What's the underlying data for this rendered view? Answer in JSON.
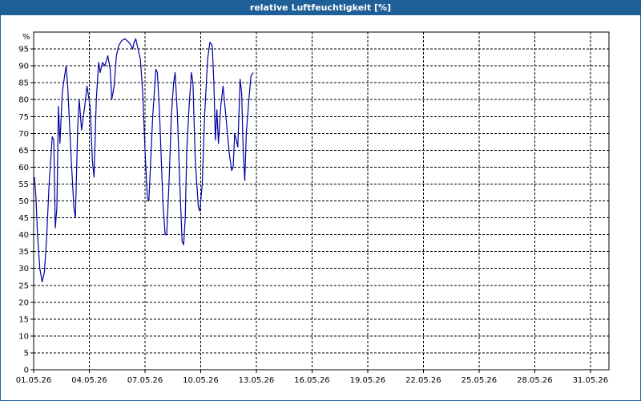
{
  "window": {
    "title": "relative Luftfeuchtigkeit [%]"
  },
  "colors": {
    "title_bar": "#1f5f97",
    "series": "#0000a0",
    "grid": "#000000",
    "plot_background": "#ffffff"
  },
  "chart_data": {
    "type": "line",
    "title": "relative Luftfeuchtigkeit [%]",
    "ylabel": "%",
    "xlabel": "",
    "grid": true,
    "grid_style": "dashed",
    "ylim": [
      0,
      100
    ],
    "xlim": [
      "01.05.26",
      "01.06.26"
    ],
    "y_ticks": [
      0,
      5,
      10,
      15,
      20,
      25,
      30,
      35,
      40,
      45,
      50,
      55,
      60,
      65,
      70,
      75,
      80,
      85,
      90,
      95
    ],
    "x_ticks": [
      {
        "label": "01.05.26",
        "date": "2026-05-01"
      },
      {
        "label": "04.05.26",
        "date": "2026-05-04"
      },
      {
        "label": "07.05.26",
        "date": "2026-05-07"
      },
      {
        "label": "10.05.26",
        "date": "2026-05-10"
      },
      {
        "label": "13.05.26",
        "date": "2026-05-13"
      },
      {
        "label": "16.05.26",
        "date": "2026-05-16"
      },
      {
        "label": "19.05.26",
        "date": "2026-05-19"
      },
      {
        "label": "22.05.26",
        "date": "2026-05-22"
      },
      {
        "label": "25.05.26",
        "date": "2026-05-25"
      },
      {
        "label": "28.05.26",
        "date": "2026-05-28"
      },
      {
        "label": "31.05.26",
        "date": "2026-05-31"
      }
    ],
    "series": [
      {
        "points": [
          [
            "2026-05-01 01:00",
            57
          ],
          [
            "2026-05-01 03:00",
            51
          ],
          [
            "2026-05-01 05:00",
            40
          ],
          [
            "2026-05-01 08:00",
            30
          ],
          [
            "2026-05-01 11:00",
            26
          ],
          [
            "2026-05-01 14:00",
            29
          ],
          [
            "2026-05-01 17:00",
            40
          ],
          [
            "2026-05-01 20:00",
            55
          ],
          [
            "2026-05-02 00:00",
            69
          ],
          [
            "2026-05-02 02:00",
            68
          ],
          [
            "2026-05-02 04:00",
            42
          ],
          [
            "2026-05-02 06:00",
            48
          ],
          [
            "2026-05-02 08:00",
            78
          ],
          [
            "2026-05-02 10:00",
            67
          ],
          [
            "2026-05-02 13:00",
            82
          ],
          [
            "2026-05-02 16:00",
            87
          ],
          [
            "2026-05-02 18:00",
            90
          ],
          [
            "2026-05-02 20:00",
            84
          ],
          [
            "2026-05-03 00:00",
            65
          ],
          [
            "2026-05-03 04:00",
            48
          ],
          [
            "2026-05-03 06:00",
            45
          ],
          [
            "2026-05-03 09:00",
            72
          ],
          [
            "2026-05-03 11:00",
            80
          ],
          [
            "2026-05-03 14:00",
            71
          ],
          [
            "2026-05-03 18:00",
            78
          ],
          [
            "2026-05-03 21:00",
            84
          ],
          [
            "2026-05-04 01:00",
            78
          ],
          [
            "2026-05-04 04:00",
            62
          ],
          [
            "2026-05-04 06:00",
            57
          ],
          [
            "2026-05-04 09:00",
            80
          ],
          [
            "2026-05-04 12:00",
            91
          ],
          [
            "2026-05-04 14:00",
            88
          ],
          [
            "2026-05-04 17:00",
            91
          ],
          [
            "2026-05-04 20:00",
            90
          ],
          [
            "2026-05-05 00:00",
            93
          ],
          [
            "2026-05-05 03:00",
            89
          ],
          [
            "2026-05-05 05:00",
            80
          ],
          [
            "2026-05-05 08:00",
            84
          ],
          [
            "2026-05-05 11:00",
            93
          ],
          [
            "2026-05-05 14:00",
            96
          ],
          [
            "2026-05-05 18:00",
            97.5
          ],
          [
            "2026-05-05 22:00",
            98
          ],
          [
            "2026-05-06 03:00",
            97
          ],
          [
            "2026-05-06 06:00",
            96
          ],
          [
            "2026-05-06 08:00",
            95
          ],
          [
            "2026-05-06 10:00",
            97
          ],
          [
            "2026-05-06 12:00",
            98
          ],
          [
            "2026-05-06 15:00",
            95
          ],
          [
            "2026-05-06 18:00",
            92
          ],
          [
            "2026-05-06 21:00",
            82
          ],
          [
            "2026-05-07 00:00",
            65
          ],
          [
            "2026-05-07 03:00",
            51
          ],
          [
            "2026-05-07 05:00",
            50
          ],
          [
            "2026-05-07 07:00",
            60
          ],
          [
            "2026-05-07 10:00",
            75
          ],
          [
            "2026-05-07 14:00",
            89
          ],
          [
            "2026-05-07 16:00",
            88
          ],
          [
            "2026-05-07 19:00",
            75
          ],
          [
            "2026-05-07 23:00",
            50
          ],
          [
            "2026-05-08 02:00",
            40
          ],
          [
            "2026-05-08 04:00",
            40
          ],
          [
            "2026-05-08 07:00",
            55
          ],
          [
            "2026-05-08 10:00",
            75
          ],
          [
            "2026-05-08 13:00",
            85
          ],
          [
            "2026-05-08 15:00",
            88
          ],
          [
            "2026-05-08 18:00",
            75
          ],
          [
            "2026-05-08 21:00",
            55
          ],
          [
            "2026-05-09 00:00",
            38
          ],
          [
            "2026-05-09 02:00",
            37
          ],
          [
            "2026-05-09 04:00",
            45
          ],
          [
            "2026-05-09 06:00",
            65
          ],
          [
            "2026-05-09 09:00",
            78
          ],
          [
            "2026-05-09 12:00",
            88
          ],
          [
            "2026-05-09 14:00",
            85
          ],
          [
            "2026-05-09 17:00",
            62
          ],
          [
            "2026-05-09 21:00",
            48
          ],
          [
            "2026-05-09 23:00",
            47
          ],
          [
            "2026-05-10 02:00",
            55
          ],
          [
            "2026-05-10 05:00",
            75
          ],
          [
            "2026-05-10 09:00",
            92
          ],
          [
            "2026-05-10 12:00",
            97
          ],
          [
            "2026-05-10 15:00",
            96
          ],
          [
            "2026-05-10 17:00",
            85
          ],
          [
            "2026-05-10 19:00",
            68
          ],
          [
            "2026-05-10 21:00",
            77
          ],
          [
            "2026-05-10 23:00",
            67
          ],
          [
            "2026-05-11 02:00",
            78
          ],
          [
            "2026-05-11 05:00",
            84
          ],
          [
            "2026-05-11 09:00",
            74
          ],
          [
            "2026-05-11 13:00",
            64
          ],
          [
            "2026-05-11 16:00",
            59
          ],
          [
            "2026-05-11 18:00",
            60
          ],
          [
            "2026-05-11 20:00",
            70
          ],
          [
            "2026-05-12 00:00",
            66
          ],
          [
            "2026-05-12 03:00",
            86
          ],
          [
            "2026-05-12 05:00",
            82
          ],
          [
            "2026-05-12 07:00",
            65
          ],
          [
            "2026-05-12 09:00",
            56
          ],
          [
            "2026-05-12 11:00",
            70
          ],
          [
            "2026-05-12 14:00",
            79
          ],
          [
            "2026-05-12 17:00",
            87
          ],
          [
            "2026-05-12 20:00",
            88
          ]
        ]
      }
    ]
  }
}
